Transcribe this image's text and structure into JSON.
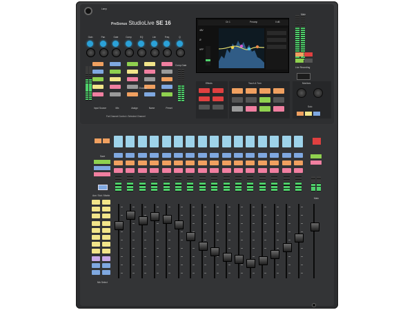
{
  "device": {
    "brand_mark": "PreSonus",
    "model_prefix": "StudioLive",
    "model_suffix": "SE 16",
    "jack_label": "Lamp"
  },
  "fat_channel": {
    "knob_labels": [
      "Gain",
      "Pan",
      "Gate",
      "Comp",
      "EQ",
      "Lim",
      "Freq",
      "Q"
    ],
    "button_labels": [
      "Input Source",
      "Mix",
      "Assign",
      "Name",
      "Preset"
    ],
    "section_label": "Channel",
    "footer_label": "Fat Channel Control • Selected Channel",
    "right_label": "Comp Gate"
  },
  "touchscreen": {
    "header_channel": "Ch 1",
    "header_preset": "Preamp",
    "header_value": "0 dB",
    "left_values": [
      "48V",
      "Ø",
      "HPF"
    ]
  },
  "right_meter": {
    "label": "Main",
    "button_label": "Live Recording"
  },
  "sections": {
    "effects": "Effects",
    "touch_turn": "Touch & Turn",
    "monitors": "Monitors",
    "solo": "Solo"
  },
  "bottom": {
    "left_label": "Save",
    "mix_label": "Aux / Sub / Matrix",
    "mix_select": "Mix Select",
    "main_label": "Main"
  },
  "colors": {
    "console": "#2e2f31",
    "lcd": "#9ed3ea",
    "green_btn": "#8fd14f",
    "orange_btn": "#f0a060",
    "blue_btn": "#7fa8e0",
    "yellow_btn": "#f2e58a",
    "red_btn": "#e04040",
    "pink_btn": "#f07fa0"
  }
}
